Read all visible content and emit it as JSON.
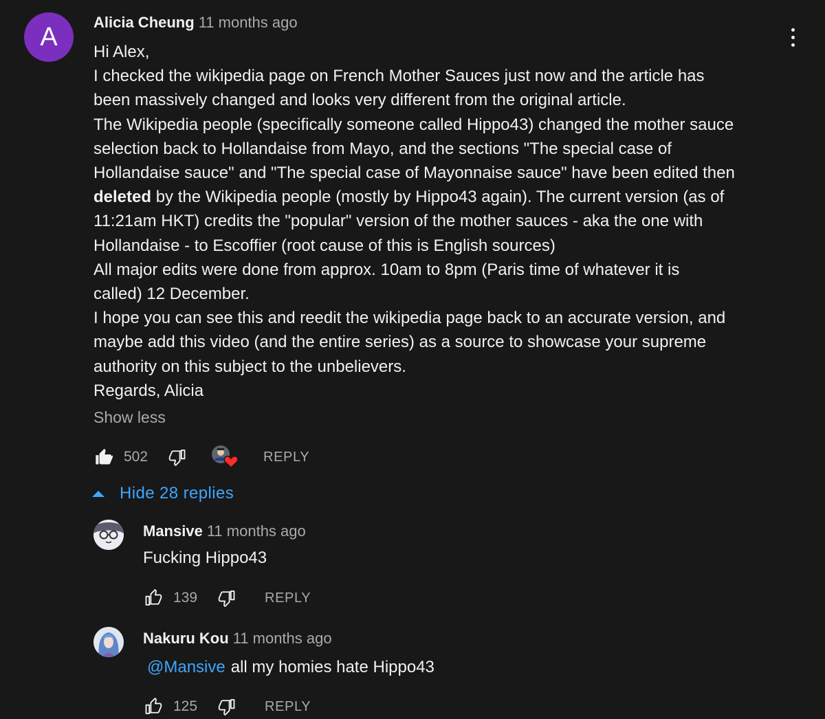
{
  "main_comment": {
    "avatar_letter": "A",
    "author": "Alicia Cheung",
    "time": "11 months ago",
    "lines": [
      "Hi Alex,",
      "I checked the wikipedia page on French Mother Sauces just now and the article has",
      "been massively changed and looks very different from the original article.",
      "The Wikipedia people (specifically someone called Hippo43) changed the mother sauce",
      "selection back to Hollandaise from Mayo, and the sections \"The special case of",
      "Hollandaise sauce\" and \"The special case of Mayonnaise sauce\" have been edited then"
    ],
    "bold_word": "deleted",
    "bold_line_rest": " by the Wikipedia people (mostly by Hippo43 again). The current version (as of",
    "lines_after": [
      "11:21am HKT) credits the \"popular\" version of the mother sauces - aka the one with",
      "Hollandaise - to Escoffier (root cause of this is English sources)",
      "All major edits were done from approx. 10am to 8pm (Paris time of whatever it is",
      "called) 12 December.",
      "I hope you can see this and reedit the wikipedia page back to an accurate version, and",
      "maybe add this video (and the entire series) as a source to showcase your supreme",
      "authority on this subject to the unbelievers.",
      "Regards, Alicia"
    ],
    "show_less": "Show less",
    "likes": "502",
    "reply_label": "REPLY",
    "liked": true
  },
  "hide_replies": "Hide 28 replies",
  "replies": [
    {
      "author": "Mansive",
      "time": "11 months ago",
      "text": "Fucking Hippo43",
      "likes": "139",
      "reply_label": "REPLY"
    },
    {
      "author": "Nakuru Kou",
      "time": "11 months ago",
      "mention": "@Mansive",
      "text": "all my homies hate Hippo43",
      "likes": "125",
      "reply_label": "REPLY"
    }
  ],
  "colors": {
    "background": "#181818",
    "text": "#f1f1f1",
    "secondary": "#aaaaaa",
    "link": "#3ea6ff",
    "avatar": "#7b2fbe",
    "heart": "#ff2a2a"
  }
}
